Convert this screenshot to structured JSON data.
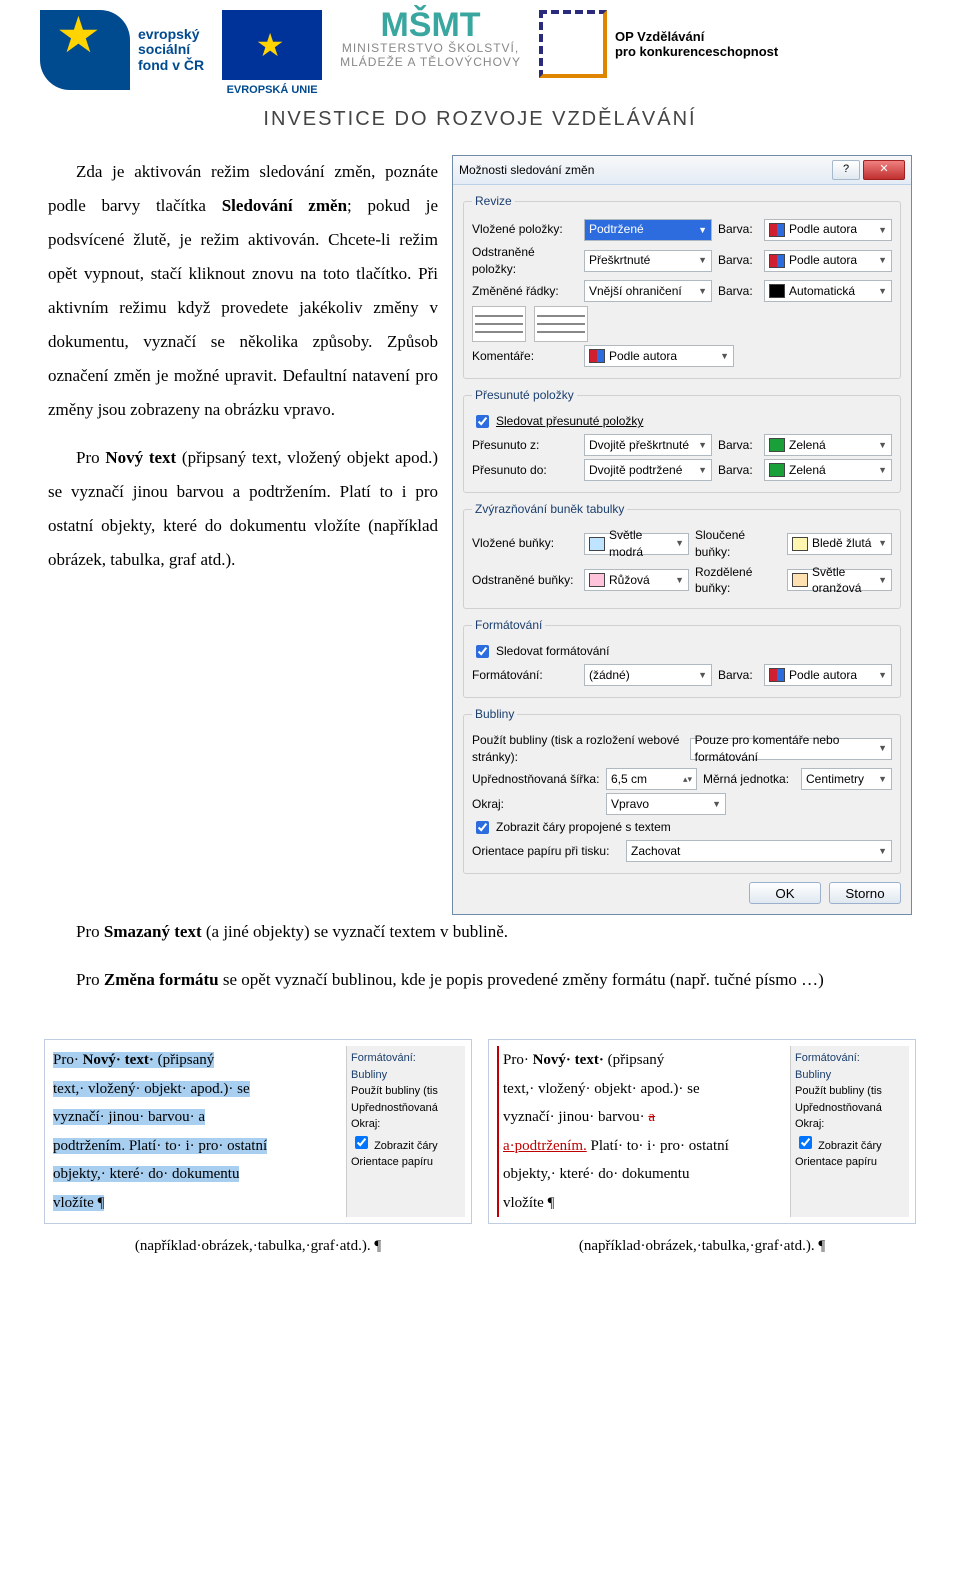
{
  "header": {
    "esf": "evropský\nsociální\nfond v ČR",
    "eu": "EVROPSKÁ UNIE",
    "msmt_big": "MŠMT",
    "msmt_line1": "MINISTERSTVO ŠKOLSTVÍ,",
    "msmt_line2": "MLÁDEŽE A TĚLOVÝCHOVY",
    "op_line1": "OP Vzdělávání",
    "op_line2": "pro konkurenceschopnost",
    "subtitle": "INVESTICE DO ROZVOJE VZDĚLÁVÁNÍ"
  },
  "para1a": "Zda je aktivován režim sledování změn, poznáte podle barvy tlačítka ",
  "para1_bold": "Sledování změn",
  "para1b": "; pokud je podsvícené žlutě, je režim aktivován. Chcete-li režim opět vypnout, stačí kliknout znovu na toto tlačítko. Při aktivním režimu když provedete jakékoliv změny v dokumentu, vyznačí se několika způsoby. Způsob označení změn je možné upravit. Defaultní natavení pro změny jsou zobrazeny na obrázku vpravo.",
  "para2a": "Pro ",
  "para2_bold": "Nový text",
  "para2b": " (připsaný text, vložený objekt apod.) se vyznačí jinou barvou a podtržením. Platí to i pro ostatní objekty, které do dokumentu vložíte (například obrázek, tabulka, graf atd.).",
  "para3a": "Pro ",
  "para3_bold": "Smazaný text",
  "para3b": " (a jiné objekty) se vyznačí textem v bublině.",
  "para4a": "Pro ",
  "para4_bold": "Změna formátu",
  "para4b": " se opět vyznačí bublinou, kde je popis provedené změny formátu (např. tučné písmo …)",
  "dialog": {
    "title": "Možnosti sledování změn",
    "group_revize": "Revize",
    "vlozene": "Vložené položky:",
    "vlozene_val": "Podtržené",
    "odstranene": "Odstraněné položky:",
    "odstranene_val": "Přeškrtnuté",
    "zmenene": "Změněné řádky:",
    "zmenene_val": "Vnější ohraničení",
    "barva": "Barva:",
    "podle_autora": "Podle autora",
    "auto": "Automatická",
    "komentare": "Komentáře:",
    "group_presunute": "Přesunuté položky",
    "sledovat_presunute": "Sledovat přesunuté položky",
    "presunuto_z": "Přesunuto z:",
    "presunuto_z_val": "Dvojitě přeškrtnuté",
    "presunuto_do": "Přesunuto do:",
    "presunuto_do_val": "Dvojitě podtržené",
    "zelena": "Zelená",
    "group_zvyraz": "Zvýrazňování buněk tabulky",
    "vloz_bunky": "Vložené buňky:",
    "svetle_modra": "Světle modrá",
    "slouc_bunky": "Sloučené buňky:",
    "blede_zluta": "Bledě žlutá",
    "odstr_bunky": "Odstraněné buňky:",
    "ruzova": "Růžová",
    "rozdel_bunky": "Rozdělené buňky:",
    "svetle_oranzova": "Světle oranžová",
    "group_format": "Formátování",
    "sledovat_format": "Sledovat formátování",
    "formatovani": "Formátování:",
    "zadne": "(žádné)",
    "group_bubliny": "Bubliny",
    "pouzit_bubliny": "Použít bubliny (tisk a rozložení webové stránky):",
    "pouzit_bubliny_val": "Pouze pro komentáře nebo formátování",
    "upred_sirka": "Upřednostňovaná šířka:",
    "upred_sirka_val": "6,5 cm",
    "merna_jednotka": "Měrná jednotka:",
    "centimetry": "Centimetry",
    "okraj": "Okraj:",
    "okraj_val": "Vpravo",
    "zobrazit_cary": "Zobrazit čáry propojené s textem",
    "orientace": "Orientace papíru při tisku:",
    "zachovat": "Zachovat",
    "ok": "OK",
    "storno": "Storno"
  },
  "snippet": {
    "t1": "Pro·  ",
    "t1b": "Nový·  text·",
    "t2": "  (připsaný ",
    "t3": "text,· vložený· objekt· apod.)·  se ",
    "t4": "vyznačí·   jinou·   barvou·   a ",
    "t5": "podtržením.",
    "t5r": " Platí· to· i· pro· ostatní ",
    "t6": "objekty,·  které·  do·  dokumentu ",
    "t7": "vložíte ¶",
    "s_red_a": "a",
    "s_red_rest": "·podtržením.",
    "side_format": "Formátování:",
    "side_bubliny": "Bubliny",
    "side_pouzit": "Použít bubliny (tis",
    "side_upred": "Upřednostňovaná",
    "side_okraj": "Okraj:",
    "side_zobr": "Zobrazit čáry",
    "side_orient": "Orientace papíru",
    "caption": "(například·obrázek,·tabulka,·graf·atd.). ¶"
  }
}
